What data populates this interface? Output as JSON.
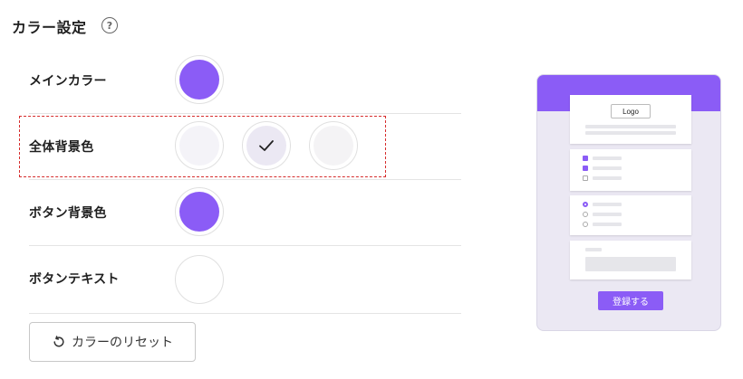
{
  "section": {
    "title": "カラー設定",
    "help_icon": "?"
  },
  "rows": [
    {
      "label": "メインカラー",
      "swatches": [
        {
          "color": "#8b5cf6",
          "selected": false
        }
      ]
    },
    {
      "label": "全体背景色",
      "swatches": [
        {
          "color": "#f4f3f8",
          "selected": false
        },
        {
          "color": "#ebe8f3",
          "selected": true
        },
        {
          "color": "#f4f3f5",
          "selected": false
        }
      ]
    },
    {
      "label": "ボタン背景色",
      "swatches": [
        {
          "color": "#8b5cf6",
          "selected": false
        }
      ]
    },
    {
      "label": "ボタンテキスト",
      "swatches": [
        {
          "color": "#ffffff",
          "selected": false
        }
      ]
    }
  ],
  "reset_button": {
    "label": "カラーのリセット",
    "icon": "reset-icon"
  },
  "preview": {
    "logo_text": "Logo",
    "submit_label": "登録する",
    "accent": "#8b5cf6",
    "background": "#ebe8f3"
  }
}
